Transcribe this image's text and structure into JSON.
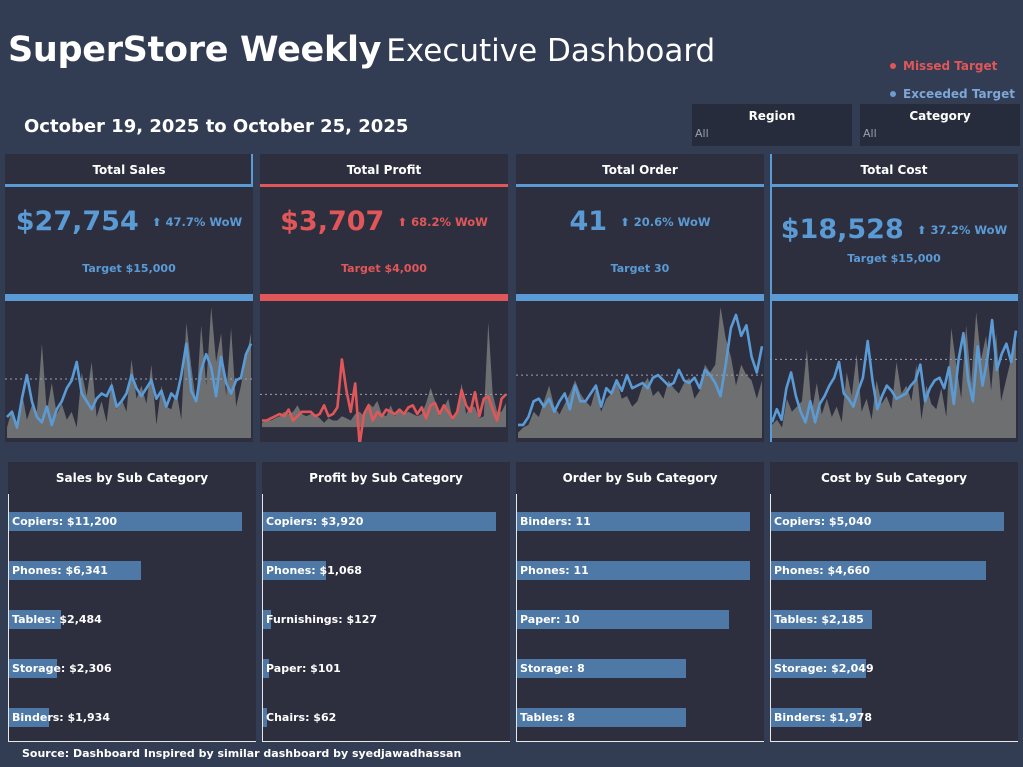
{
  "title": {
    "bold": "SuperStore Weekly",
    "light": "Executive Dashboard"
  },
  "legend": [
    {
      "label": "Missed Target",
      "color": "#e15759"
    },
    {
      "label": "Exceeded Target",
      "color": "#5b9bd5"
    }
  ],
  "date_range": "October 19, 2025 to October 25, 2025",
  "filters": [
    {
      "label": "Region",
      "value": "All"
    },
    {
      "label": "Category",
      "value": "All"
    }
  ],
  "colors": {
    "exceeded": "#5b9bd5",
    "missed": "#e15759",
    "area": "#7a7a7a",
    "background": "#323c52",
    "panel": "#2d2f3f"
  },
  "kpis": [
    {
      "title": "Total Sales",
      "value": "$27,754",
      "wow": "47.7% WoW",
      "target": "Target $15,000",
      "status": "exceeded"
    },
    {
      "title": "Total Profit",
      "value": "$3,707",
      "wow": "68.2% WoW",
      "target": "Target $4,000",
      "status": "missed"
    },
    {
      "title": "Total Order",
      "value": "41",
      "wow": "20.6% WoW",
      "target": "Target 30",
      "status": "exceeded"
    },
    {
      "title": "Total Cost",
      "value": "$18,528",
      "wow": "37.2%  WoW",
      "target": "Target $15,000",
      "status": "exceeded"
    }
  ],
  "chart_data": [
    {
      "type": "area",
      "title": "Total Sales",
      "ymin": 0,
      "ymax": 100,
      "reference": 45,
      "area": [
        8,
        22,
        8,
        35,
        14,
        25,
        20,
        72,
        20,
        42,
        18,
        26,
        14,
        20,
        8,
        50,
        32,
        58,
        16,
        28,
        12,
        44,
        22,
        30,
        20,
        60,
        30,
        40,
        26,
        56,
        10,
        40,
        24,
        22,
        36,
        14,
        88,
        55,
        26,
        86,
        40,
        100,
        58,
        80,
        32,
        84,
        24,
        40,
        60,
        80
      ],
      "line": [
        16,
        20,
        8,
        30,
        48,
        28,
        16,
        12,
        24,
        10,
        22,
        28,
        38,
        44,
        58,
        34,
        28,
        22,
        30,
        34,
        32,
        40,
        24,
        28,
        34,
        48,
        38,
        32,
        38,
        44,
        30,
        36,
        24,
        34,
        30,
        48,
        72,
        36,
        28,
        52,
        64,
        54,
        32,
        62,
        42,
        34,
        44,
        46,
        64,
        72
      ]
    },
    {
      "type": "area",
      "title": "Total Profit",
      "ymin": -10,
      "ymax": 110,
      "reference": 30,
      "area": [
        4,
        6,
        6,
        8,
        10,
        14,
        12,
        14,
        20,
        12,
        10,
        12,
        12,
        8,
        4,
        8,
        6,
        6,
        10,
        8,
        6,
        12,
        14,
        10,
        22,
        18,
        24,
        12,
        10,
        20,
        10,
        16,
        12,
        14,
        12,
        10,
        12,
        22,
        36,
        24,
        10,
        18,
        26,
        6,
        14,
        40,
        12,
        20,
        18,
        8,
        10,
        96,
        30,
        14,
        14,
        22
      ],
      "line": [
        6,
        6,
        8,
        10,
        12,
        10,
        16,
        6,
        10,
        14,
        14,
        14,
        10,
        12,
        20,
        10,
        12,
        18,
        62,
        34,
        14,
        40,
        -16,
        12,
        20,
        6,
        14,
        10,
        16,
        14,
        12,
        16,
        12,
        18,
        20,
        12,
        18,
        8,
        20,
        22,
        12,
        20,
        14,
        8,
        14,
        34,
        20,
        14,
        32,
        10,
        26,
        28,
        16,
        6,
        26,
        30
      ]
    },
    {
      "type": "area",
      "title": "Total Order",
      "ymin": 0,
      "ymax": 100,
      "reference": 48,
      "area": [
        4,
        8,
        10,
        20,
        16,
        28,
        40,
        24,
        18,
        26,
        34,
        44,
        34,
        28,
        24,
        38,
        20,
        30,
        34,
        44,
        30,
        32,
        24,
        28,
        40,
        46,
        32,
        36,
        30,
        44,
        38,
        34,
        42,
        46,
        30,
        36,
        56,
        50,
        56,
        100,
        76,
        62,
        40,
        56,
        48,
        44,
        30,
        44
      ],
      "line": [
        10,
        10,
        16,
        28,
        30,
        24,
        30,
        20,
        28,
        34,
        22,
        40,
        28,
        28,
        34,
        40,
        24,
        38,
        34,
        44,
        36,
        48,
        38,
        40,
        42,
        38,
        46,
        48,
        44,
        40,
        42,
        52,
        44,
        42,
        46,
        38,
        52,
        48,
        42,
        32,
        56,
        84,
        94,
        78,
        86,
        62,
        50,
        70
      ]
    },
    {
      "type": "area",
      "title": "Total Cost",
      "ymin": 0,
      "ymax": 100,
      "reference": 60,
      "area": [
        10,
        14,
        8,
        30,
        20,
        24,
        28,
        68,
        20,
        42,
        18,
        30,
        16,
        24,
        12,
        50,
        32,
        64,
        20,
        30,
        14,
        44,
        26,
        32,
        22,
        58,
        34,
        40,
        28,
        56,
        14,
        40,
        26,
        22,
        38,
        16,
        84,
        56,
        30,
        86,
        42,
        96,
        60,
        78,
        36,
        80,
        28,
        44,
        60,
        80
      ],
      "line": [
        12,
        22,
        14,
        38,
        50,
        32,
        20,
        12,
        28,
        12,
        26,
        32,
        40,
        46,
        58,
        34,
        30,
        24,
        36,
        46,
        74,
        44,
        22,
        32,
        40,
        36,
        30,
        32,
        34,
        40,
        44,
        56,
        28,
        38,
        44,
        46,
        38,
        54,
        26,
        60,
        80,
        44,
        28,
        70,
        40,
        60,
        90,
        52,
        64,
        72,
        58,
        82
      ]
    },
    {
      "type": "bar",
      "title": "Sales by Sub Category",
      "categories": [
        "Copiers",
        "Phones",
        "Tables",
        "Storage",
        "Binders"
      ],
      "values": [
        11200,
        6341,
        2484,
        2306,
        1934
      ],
      "labels": [
        "Copiers: $11,200",
        "Phones: $6,341",
        "Tables: $2,484",
        "Storage: $2,306",
        "Binders: $1,934"
      ]
    },
    {
      "type": "bar",
      "title": "Profit by Sub Category",
      "categories": [
        "Copiers",
        "Phones",
        "Furnishings",
        "Paper",
        "Chairs"
      ],
      "values": [
        3920,
        1068,
        127,
        101,
        62
      ],
      "labels": [
        "Copiers: $3,920",
        "Phones: $1,068",
        "Furnishings: $127",
        "Paper: $101",
        "Chairs: $62"
      ]
    },
    {
      "type": "bar",
      "title": "Order by Sub Category",
      "categories": [
        "Binders",
        "Phones",
        "Paper",
        "Storage",
        "Tables"
      ],
      "values": [
        11,
        11,
        10,
        8,
        8
      ],
      "labels": [
        "Binders: 11",
        "Phones: 11",
        "Paper: 10",
        "Storage: 8",
        "Tables: 8"
      ]
    },
    {
      "type": "bar",
      "title": "Cost by Sub Category",
      "categories": [
        "Copiers",
        "Phones",
        "Tables",
        "Storage",
        "Binders"
      ],
      "values": [
        5040,
        4660,
        2185,
        2049,
        1978
      ],
      "labels": [
        "Copiers: $5,040",
        "Phones: $4,660",
        "Tables: $2,185",
        "Storage: $2,049",
        "Binders: $1,978"
      ]
    }
  ],
  "source": "Source: Dashboard Inspired by similar dashboard by syedjawadhassan"
}
